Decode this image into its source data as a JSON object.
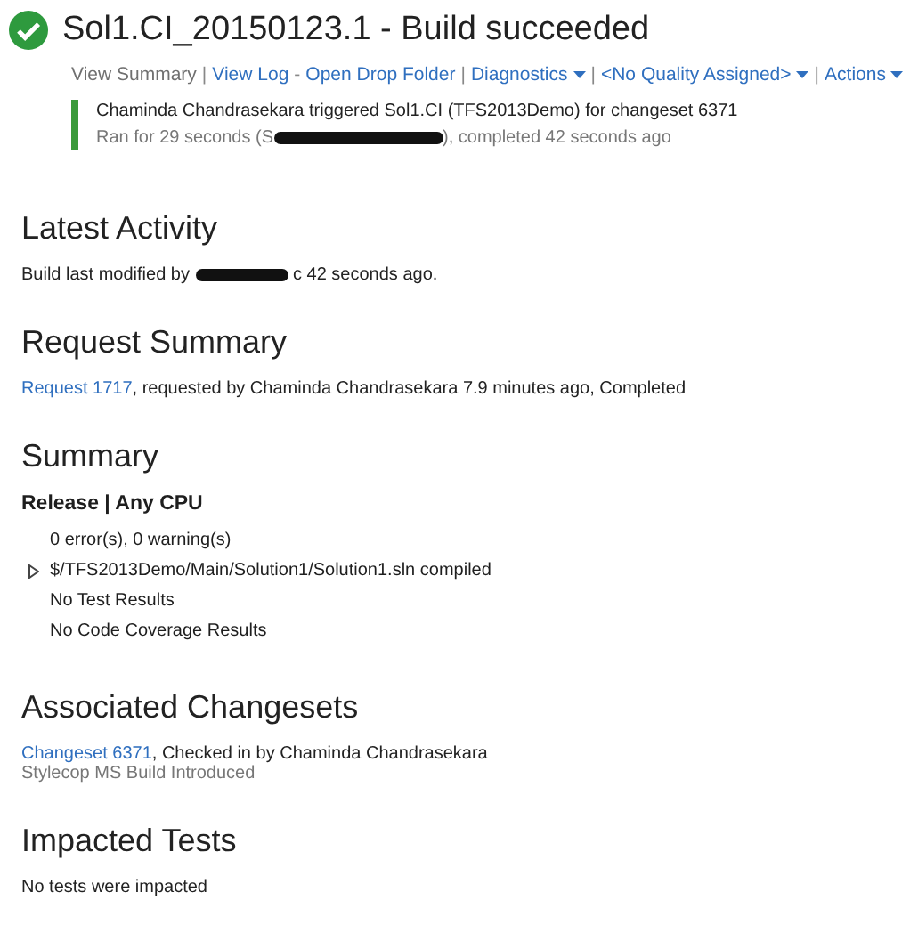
{
  "header": {
    "title": "Sol1.CI_20150123.1 - Build succeeded"
  },
  "toolbar": [
    {
      "label": "View Summary",
      "selected": true,
      "has_menu": false,
      "separator": "|"
    },
    {
      "label": "View Log",
      "selected": false,
      "has_menu": false,
      "separator": "-"
    },
    {
      "label": "Open Drop Folder",
      "selected": false,
      "has_menu": false,
      "separator": "|"
    },
    {
      "label": "Diagnostics",
      "selected": false,
      "has_menu": true,
      "separator": "|"
    },
    {
      "label": "<No Quality Assigned>",
      "selected": false,
      "has_menu": true,
      "separator": "|"
    },
    {
      "label": "Actions",
      "selected": false,
      "has_menu": true
    }
  ],
  "trigger": {
    "line": "Chaminda Chandrasekara triggered Sol1.CI (TFS2013Demo) for changeset 6371",
    "run_before": "Ran for 29 seconds (S",
    "run_after": "), completed 42 seconds ago"
  },
  "latest_activity": {
    "heading": "Latest Activity",
    "before": "Build last modified by",
    "after": "c 42 seconds ago."
  },
  "request_summary": {
    "heading": "Request Summary",
    "link": "Request 1717",
    "text": ", requested by Chaminda Chandrasekara 7.9 minutes ago, Completed"
  },
  "summary": {
    "heading": "Summary",
    "configuration": "Release | Any CPU",
    "lines": [
      {
        "text": "0 error(s), 0 warning(s)",
        "expandable": false
      },
      {
        "text": "$/TFS2013Demo/Main/Solution1/Solution1.sln compiled",
        "expandable": true
      },
      {
        "text": "No Test Results",
        "expandable": false
      },
      {
        "text": "No Code Coverage Results",
        "expandable": false
      }
    ]
  },
  "associated_changesets": {
    "heading": "Associated Changesets",
    "link": "Changeset 6371",
    "text": ", Checked in by Chaminda Chandrasekara",
    "comment": "Stylecop MS Build Introduced"
  },
  "impacted_tests": {
    "heading": "Impacted Tests",
    "text": "No tests were impacted"
  }
}
